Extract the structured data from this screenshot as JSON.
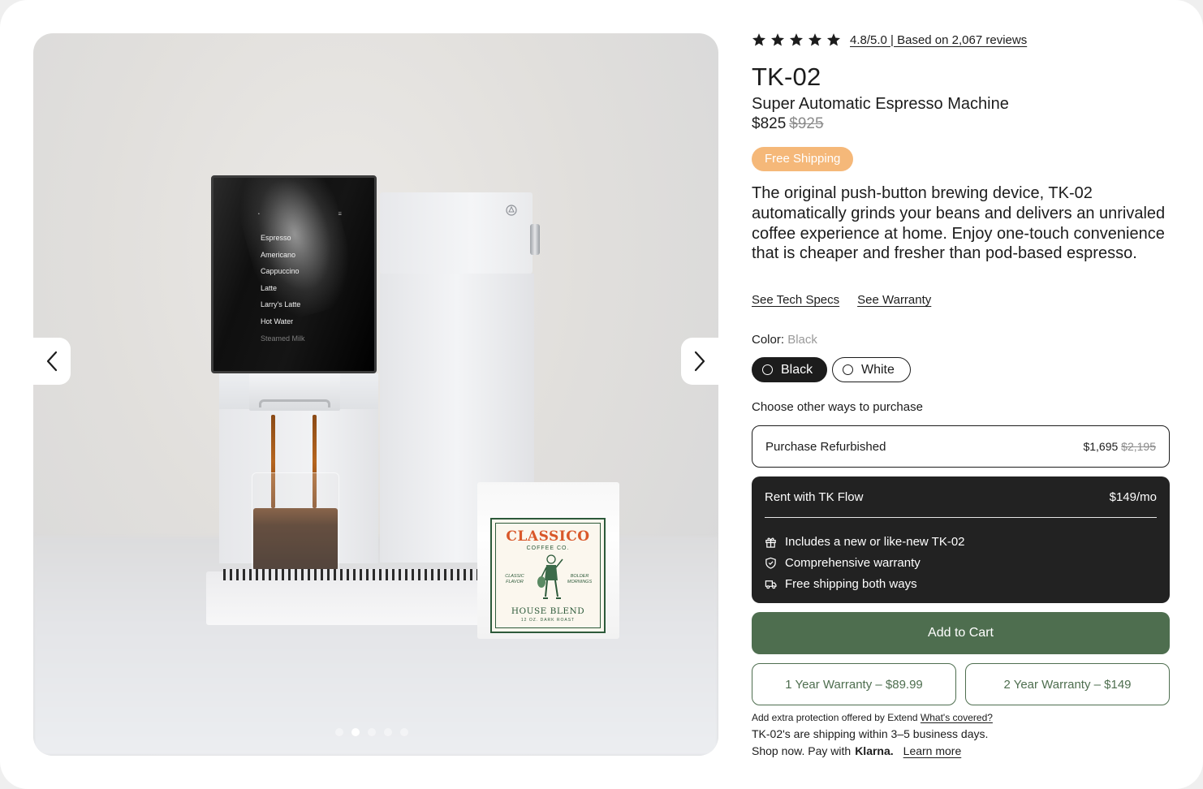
{
  "gallery": {
    "prev_icon": "chevron-left-icon",
    "next_icon": "chevron-right-icon",
    "dots_count": 5,
    "active_dot": 1,
    "machine_screen": {
      "menu": [
        "Espresso",
        "Americano",
        "Cappuccino",
        "Latte",
        "Larry's Latte",
        "Hot Water",
        "Steamed Milk"
      ]
    },
    "coffee_bag": {
      "brand": "CLASSICO",
      "brand_sub": "COFFEE CO.",
      "left_tag": "CLASSIC FLAVOR",
      "right_tag": "BOLDER MORNINGS",
      "blend": "HOUSE BLEND",
      "blend_sub": "12 OZ. DARK ROAST"
    }
  },
  "rating": {
    "stars": 5,
    "text": "4.8/5.0 | Based on 2,067 reviews"
  },
  "product": {
    "title": "TK-02",
    "subtitle": "Super Automatic Espresso Machine",
    "price": "$825",
    "price_old": "$925",
    "badge": "Free Shipping",
    "description": "The original push-button brewing device, TK-02 automatically grinds your beans and delivers an unrivaled coffee experience at home. Enjoy one-touch convenience that is cheaper and fresher than pod-based espresso.",
    "links": {
      "tech_specs": "See Tech Specs",
      "warranty": "See Warranty"
    }
  },
  "color": {
    "label": "Color:",
    "selected": "Black",
    "options": [
      "Black",
      "White"
    ]
  },
  "purchase": {
    "label": "Choose other ways to purchase",
    "refurbished": {
      "label": "Purchase Refurbished",
      "price": "$1,695",
      "price_old": "$2,195"
    },
    "rent": {
      "label": "Rent with TK Flow",
      "price": "$149/mo",
      "features": [
        {
          "icon": "gift-icon",
          "text": "Includes a new or like-new TK-02"
        },
        {
          "icon": "shield-check-icon",
          "text": "Comprehensive warranty"
        },
        {
          "icon": "truck-icon",
          "text": "Free shipping both ways"
        }
      ]
    }
  },
  "cart": {
    "label": "Add to Cart"
  },
  "warranty": {
    "one_year": "1 Year Warranty – $89.99",
    "two_year": "2 Year Warranty – $149"
  },
  "footer": {
    "extend_text": "Add extra protection offered by Extend",
    "extend_link": "What's covered?",
    "shipping": "TK-02's are shipping within 3–5 business days.",
    "klarna_prefix": "Shop now. Pay with",
    "klarna_logo": "Klarna.",
    "klarna_link": "Learn more"
  },
  "colors": {
    "accent_green": "#4e6e4f",
    "badge_orange": "#f5b879",
    "dark": "#222222"
  }
}
